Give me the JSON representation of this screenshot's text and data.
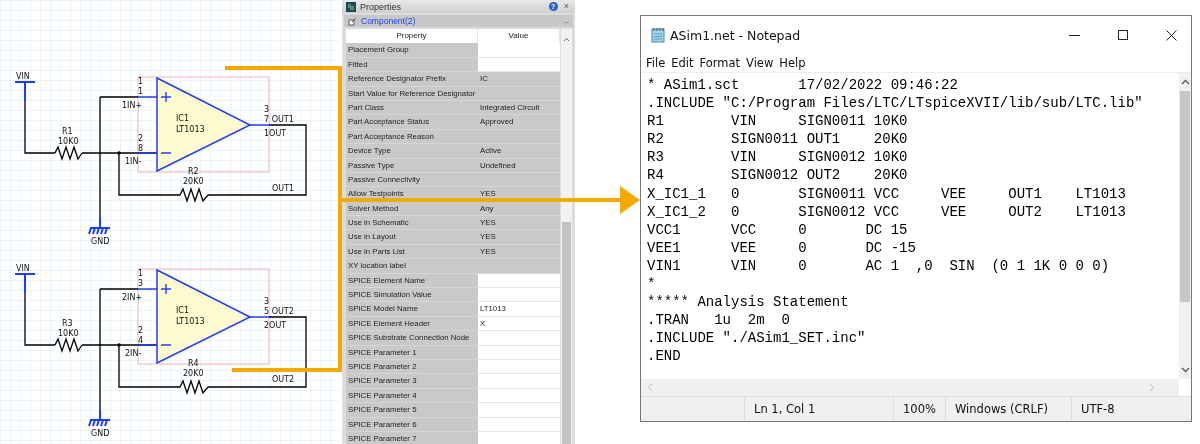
{
  "schematic": {
    "circuits": [
      {
        "input": "VIN",
        "ground": "GND",
        "resistor_in": {
          "name": "R1",
          "value": "10K0"
        },
        "resistor_fb": {
          "name": "R2",
          "value": "20K0"
        },
        "opamp": {
          "name": "IC1",
          "part": "LT1013"
        },
        "plus_pins": [
          "1",
          "1"
        ],
        "plus_label": "1IN+",
        "minus_pins": [
          "2",
          "8"
        ],
        "minus_label": "1IN-",
        "out_pins": [
          "3",
          "7 OUT1"
        ],
        "out_label": "1OUT",
        "net_label": "OUT1"
      },
      {
        "input": "VIN",
        "ground": "GND",
        "resistor_in": {
          "name": "R3",
          "value": "10K0"
        },
        "resistor_fb": {
          "name": "R4",
          "value": "20K0"
        },
        "opamp": {
          "name": "IC1",
          "part": "LT1013"
        },
        "plus_pins": [
          "1",
          "3"
        ],
        "plus_label": "2IN+",
        "minus_pins": [
          "2",
          "4"
        ],
        "minus_label": "2IN-",
        "out_pins": [
          "3",
          "5 OUT2"
        ],
        "out_label": "2OUT",
        "net_label": "OUT2"
      }
    ]
  },
  "properties": {
    "title": "Properties",
    "help": "?",
    "close": "×",
    "section": "Component(2)",
    "collapse": "–",
    "columns": [
      "Property",
      "Value"
    ],
    "rows": [
      {
        "property": "Placement Group",
        "value": "",
        "read_only": false
      },
      {
        "property": "Fitted",
        "value": "",
        "read_only": false
      },
      {
        "property": "Reference Designator Prefix",
        "value": "IC",
        "read_only": true
      },
      {
        "property": "Start Value for Reference Designator",
        "value": "",
        "read_only": true
      },
      {
        "property": "Part Class",
        "value": "Integrated Circuit",
        "read_only": true
      },
      {
        "property": "Part Acceptance Status",
        "value": "Approved",
        "read_only": true
      },
      {
        "property": "Part Acceptance Reason",
        "value": "",
        "read_only": true
      },
      {
        "property": "Device Type",
        "value": "Active",
        "read_only": true
      },
      {
        "property": "Passive Type",
        "value": "Undefined",
        "read_only": true
      },
      {
        "property": "Passive Connectivity",
        "value": "",
        "read_only": true
      },
      {
        "property": "Allow Testpoints",
        "value": "YES",
        "read_only": true
      },
      {
        "property": "Solver Method",
        "value": "Any",
        "read_only": true
      },
      {
        "property": "Use in Schematic",
        "value": "YES",
        "read_only": true
      },
      {
        "property": "Use in Layout",
        "value": "YES",
        "read_only": true
      },
      {
        "property": "Use in Parts List",
        "value": "YES",
        "read_only": true
      },
      {
        "property": "XY location label",
        "value": "",
        "read_only": true
      },
      {
        "property": "SPICE Element Name",
        "value": "",
        "read_only": false
      },
      {
        "property": "SPICE Simulation Value",
        "value": "",
        "read_only": false
      },
      {
        "property": "SPICE Model Name",
        "value": "LT1013",
        "read_only": false
      },
      {
        "property": "SPICE Element Header",
        "value": "X",
        "read_only": false
      },
      {
        "property": "SPICE Substrate Connection Node",
        "value": "",
        "read_only": false
      },
      {
        "property": "SPICE Parameter 1",
        "value": "",
        "read_only": false
      },
      {
        "property": "SPICE Parameter 2",
        "value": "",
        "read_only": false
      },
      {
        "property": "SPICE Parameter 3",
        "value": "",
        "read_only": false
      },
      {
        "property": "SPICE Parameter 4",
        "value": "",
        "read_only": false
      },
      {
        "property": "SPICE Parameter 5",
        "value": "",
        "read_only": false
      },
      {
        "property": "SPICE Parameter 6",
        "value": "",
        "read_only": false
      },
      {
        "property": "SPICE Parameter 7",
        "value": "",
        "read_only": false
      }
    ]
  },
  "notepad": {
    "title": "ASim1.net - Notepad",
    "menu": [
      "File",
      "Edit",
      "Format",
      "View",
      "Help"
    ],
    "lines": [
      "* ASim1.sct       17/02/2022 09:46:22",
      ".INCLUDE \"C:/Program Files/LTC/LTspiceXVII/lib/sub/LTC.lib\"",
      "R1        VIN     SIGN0011 10K0",
      "R2        SIGN0011 OUT1    20K0",
      "R3        VIN     SIGN0012 10K0",
      "R4        SIGN0012 OUT2    20K0",
      "X_IC1_1   0       SIGN0011 VCC     VEE     OUT1    LT1013",
      "X_IC1_2   0       SIGN0012 VCC     VEE     OUT2    LT1013",
      "VCC1      VCC     0       DC 15",
      "VEE1      VEE     0       DC -15",
      "VIN1      VIN     0       AC 1  ,0  SIN  (0 1 1K 0 0 0)",
      "*",
      "***** Analysis Statement",
      ".TRAN   1u  2m  0",
      ".INCLUDE \"./ASim1_SET.inc\"",
      ".END"
    ],
    "status": [
      "Ln 1, Col 1",
      "100%",
      "Windows (CRLF)",
      "UTF-8"
    ]
  }
}
